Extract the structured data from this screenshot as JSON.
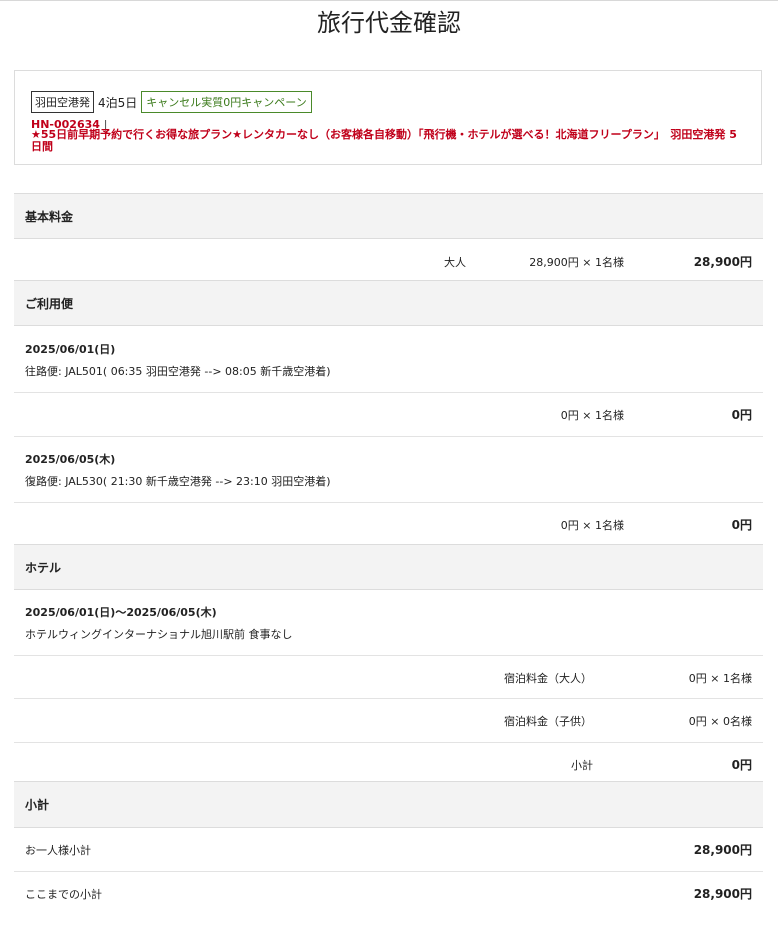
{
  "page": {
    "title": "旅行代金確認"
  },
  "plan": {
    "origin_tag": "羽田空港発",
    "duration": "4泊5日",
    "campaign_tag": "キャンセル実質0円キャンペーン",
    "code": "HN-002634",
    "code_separator": "|",
    "name": "★55日前早期予約で行くお得な旅プラン★レンタカーなし（お客様各自移動）「飛行機・ホテルが選べる！北海道フリープラン」　羽田空港発 5日間"
  },
  "basic_fee": {
    "heading": "基本料金",
    "label": "大人",
    "unit_calc": "28,900円 × 1名様",
    "total": "28,900円"
  },
  "flights": {
    "heading": "ご利用便",
    "items": [
      {
        "date": "2025/06/01(日)",
        "detail": "往路便: JAL501( 06:35 羽田空港発 --> 08:05 新千歳空港着)",
        "unit_calc": "0円 × 1名様",
        "total": "0円"
      },
      {
        "date": "2025/06/05(木)",
        "detail": "復路便: JAL530( 21:30 新千歳空港発 --> 23:10 羽田空港着)",
        "unit_calc": "0円 × 1名様",
        "total": "0円"
      }
    ]
  },
  "hotel": {
    "heading": "ホテル",
    "dates": "2025/06/01(日)～2025/06/05(木)",
    "name": "ホテルウィングインターナショナル旭川駅前 食事なし",
    "adult_label": "宿泊料金（大人）",
    "adult_calc": "0円 × 1名様",
    "child_label": "宿泊料金（子供）",
    "child_calc": "0円 × 0名様",
    "subtotal_label": "小計",
    "subtotal": "0円"
  },
  "summary": {
    "heading": "小計",
    "per_person_label": "お一人様小計",
    "per_person": "28,900円",
    "so_far_label": "ここまでの小計",
    "so_far": "28,900円"
  }
}
